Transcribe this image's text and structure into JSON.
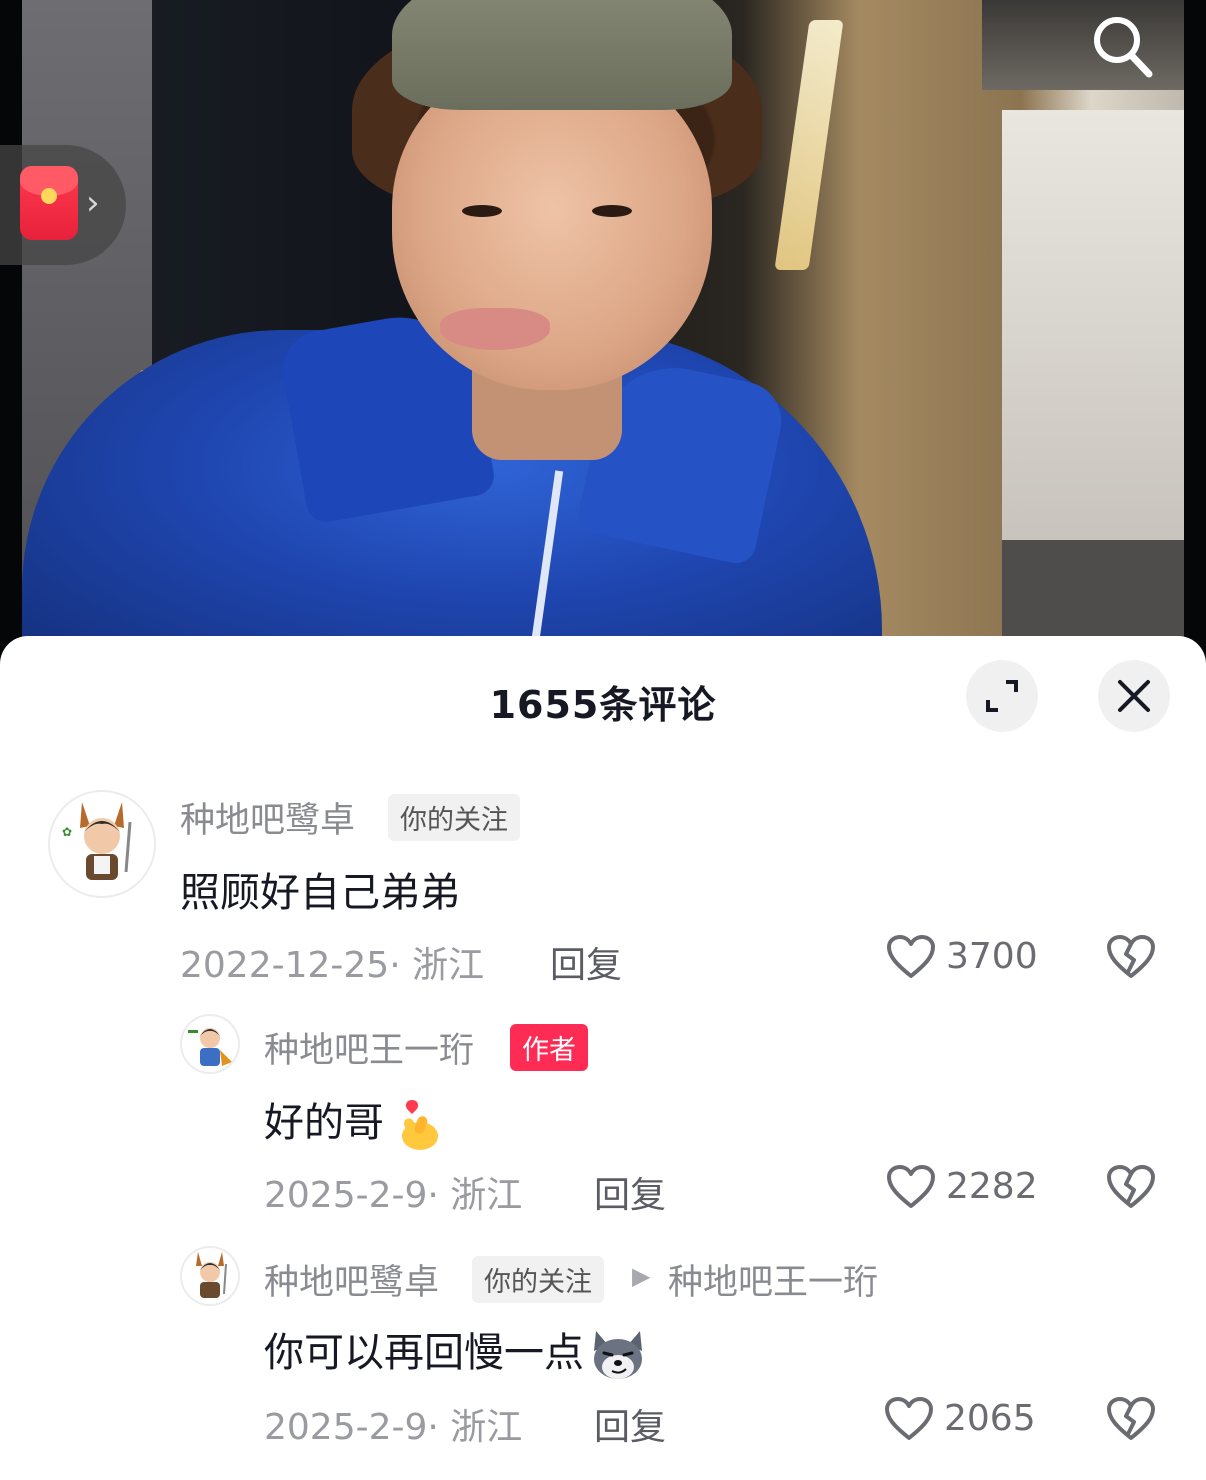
{
  "header": {
    "title": "1655条评论"
  },
  "icons": {
    "search": "search-icon",
    "red_packet": "red-packet-icon",
    "expand": "expand-icon",
    "close": "close-icon",
    "like": "heart-icon",
    "dislike": "broken-heart-icon"
  },
  "colors": {
    "author_tag": "#fe2c55",
    "text": "#161823",
    "muted": "#8a8b91"
  },
  "comments": [
    {
      "username": "种地吧鹭卓",
      "tag": "你的关注",
      "text": "照顾好自己弟弟",
      "date": "2022-12-25",
      "location": "浙江",
      "reply_label": "回复",
      "likes": "3700"
    },
    {
      "username": "种地吧王一珩",
      "tag": "作者",
      "text": "好的哥",
      "emoji": "finger-heart-emoji",
      "date": "2025-2-9",
      "location": "浙江",
      "reply_label": "回复",
      "likes": "2282"
    },
    {
      "username": "种地吧鹭卓",
      "tag": "你的关注",
      "reply_to": "种地吧王一珩",
      "text": "你可以再回慢一点",
      "emoji": "smirk-dog-emoji",
      "date": "2025-2-9",
      "location": "浙江",
      "reply_label": "回复",
      "likes": "2065"
    }
  ]
}
